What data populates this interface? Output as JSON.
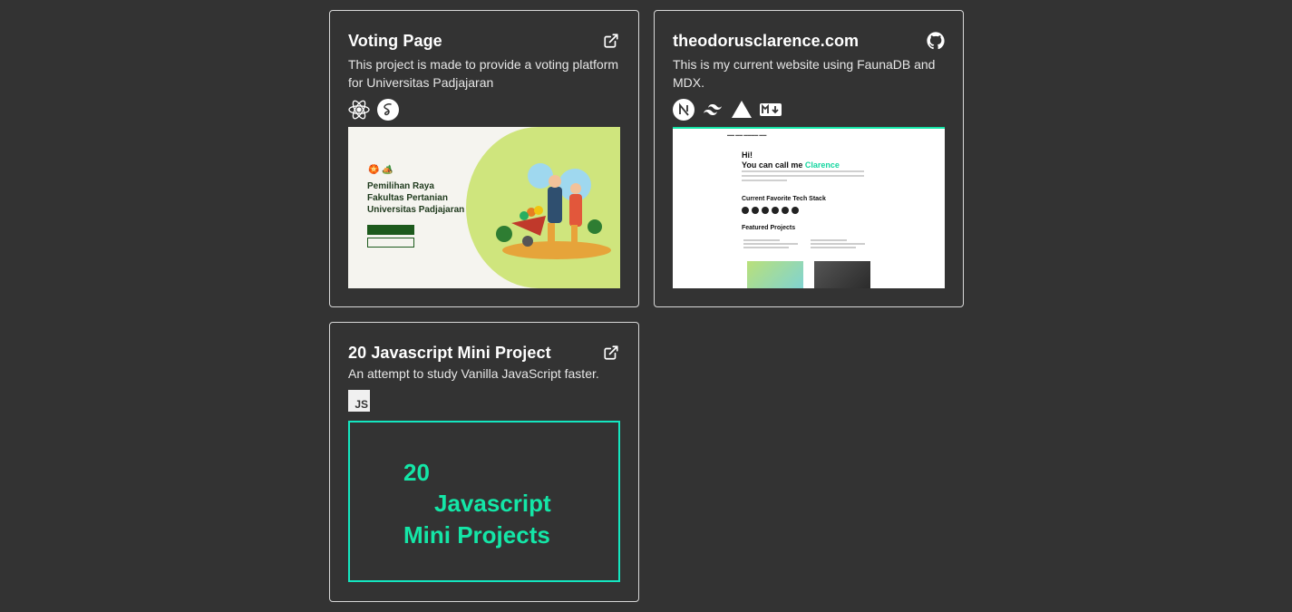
{
  "projects": [
    {
      "title": "Voting Page",
      "description": "This project is made to provide a voting platform for Universitas Padjajaran",
      "link_icon": "external-link-icon",
      "tech_icons": [
        "react-icon",
        "sass-icon"
      ],
      "preview": {
        "lines": [
          "Pemilihan Raya",
          "Fakultas Pertanian",
          "Universitas Padjajaran"
        ]
      }
    },
    {
      "title": "theodorusclarence.com",
      "description": "This is my current website using FaunaDB and MDX.",
      "link_icon": "github-icon",
      "tech_icons": [
        "nextjs-icon",
        "tailwind-icon",
        "vercel-icon",
        "markdown-icon"
      ],
      "preview": {
        "greeting": "Hi!",
        "intro": "You can call me ",
        "name": "Clarence",
        "tech_heading": "Current Favorite Tech Stack",
        "projects_heading": "Featured Projects"
      }
    },
    {
      "title": "20 Javascript Mini Project",
      "description": "An attempt to study Vanilla JavaScript faster.",
      "link_icon": "external-link-icon",
      "tech_icons": [
        "javascript-icon"
      ],
      "preview": {
        "line1": "20",
        "line2": "Javascript",
        "line3": "Mini Projects"
      }
    }
  ],
  "colors": {
    "background": "#333333",
    "border": "#d8d8d8",
    "accent": "#14e6a7"
  },
  "icon_labels": {
    "js": "JS"
  }
}
